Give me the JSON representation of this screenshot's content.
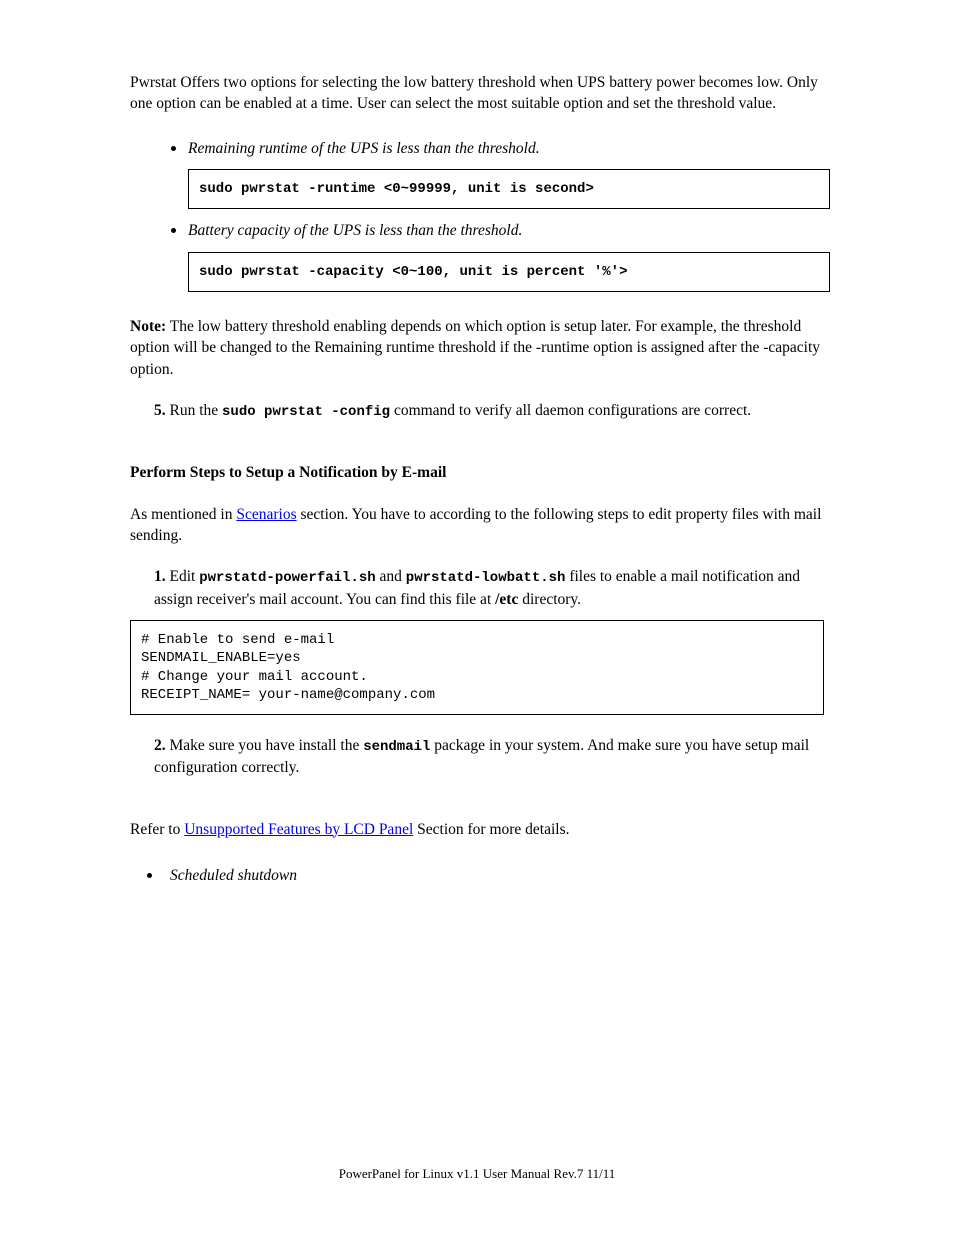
{
  "intro_para": "Pwrstat Offers two options for selecting the low battery threshold when UPS battery power becomes low. Only one option can be enabled at a time. User can select the most suitable option and set the threshold value.",
  "options": [
    {
      "heading": "Remaining runtime of the UPS is less than the threshold.",
      "code": "sudo pwrstat -runtime <0~99999, unit is second>"
    },
    {
      "heading": "Battery capacity of the UPS is less than the threshold.",
      "code": "sudo pwrstat -capacity <0~100, unit is percent '%'>"
    }
  ],
  "note_label": "Note:",
  "note_text": " The low battery threshold enabling depends on which option is setup later. For example, the threshold option will be changed to the Remaining runtime threshold if the -runtime option is assigned after the -capacity option.",
  "step5": {
    "label": "5. ",
    "prefix": "Run the ",
    "cmd": "sudo pwrstat -config",
    "suffix": " command to verify all daemon configurations are correct."
  },
  "section_header": "Perform Steps to Setup a Notification by E-mail",
  "email_intro": {
    "prefix": "As mentioned in ",
    "link_text": "Scenarios",
    "suffix": " section. You have to according to the following steps to edit property files with mail sending."
  },
  "step1": {
    "label": "1. ",
    "prefix": "Edit ",
    "file1": "pwrstatd-powerfail.sh",
    "mid": " and ",
    "file2": "pwrstatd-lowbatt.sh",
    "suffix1": " files to enable a mail notification and assign receiver's mail account. You can find this file at ",
    "path": "/etc",
    "suffix2": " directory."
  },
  "code_block": "# Enable to send e-mail\nSENDMAIL_ENABLE=yes\n# Change your mail account.\nRECEIPT_NAME= your-name@company.com",
  "step2": {
    "label": "2. ",
    "prefix": "Make sure you have install the ",
    "pkg": "sendmail",
    "suffix": " package in your system. And make sure you have setup mail configuration correctly."
  },
  "unavailable": {
    "intro_prefix": "Refer to ",
    "intro_link": "Unsupported Features by LCD Panel",
    "intro_suffix": " Section for more details.",
    "items_first": "Scheduled shutdown"
  },
  "footer_text": "PowerPanel for Linux v1.1 User Manual Rev.7     11/11"
}
